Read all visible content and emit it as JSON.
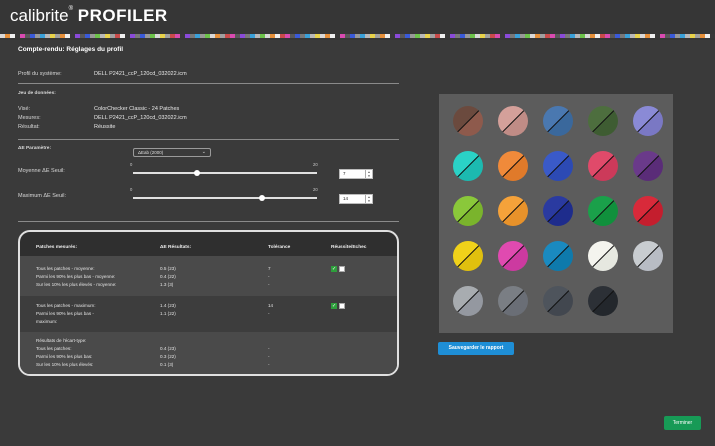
{
  "app": {
    "logo_main": "calibrite",
    "logo_reg": "®",
    "logo_product": "PROFILER",
    "strip_colors": [
      "#d8d8d8",
      "#b8b8b8",
      "#989898",
      "#787878",
      "#585858",
      "#383838",
      "#c94b4b",
      "#e6903a",
      "#e8d24a",
      "#6cc24a",
      "#3aa0d8",
      "#3a5ad8",
      "#8a4ad8",
      "#d84ab0",
      "#f0f0f0",
      "#a0a0a0"
    ]
  },
  "page": {
    "title": "Compte-rendu: Réglages du profil",
    "system_profile_label": "Profil du système:",
    "system_profile_value": "DELL P2421_ccP_120cd_032022.icm"
  },
  "dataset": {
    "heading": "Jeu de données:",
    "rows": [
      {
        "label": "Visé:",
        "value": "ColorChecker Classic - 24 Patches"
      },
      {
        "label": "Mesures:",
        "value": "DELL P2421_ccP_120cd_032022.icm"
      },
      {
        "label": "Résultat:",
        "value": "Réussite"
      }
    ]
  },
  "params": {
    "heading": "ΔE Paramètre:",
    "select_value": "ΔEab (2000)",
    "avg_label": "Moyenne ΔE Seuil:",
    "avg_min": "0",
    "avg_max": "20",
    "avg_value": "7",
    "avg_fraction": 0.35,
    "max_label": "Maximum ΔE Seuil:",
    "max_min": "0",
    "max_max": "20",
    "max_value": "14",
    "max_fraction": 0.7
  },
  "table": {
    "headers": [
      "Patches mesurés:",
      "ΔE Résultats:",
      "Tolérance",
      "Réussite/Echec"
    ],
    "groups": [
      {
        "rows": [
          {
            "label": "Tous les patches - moyenne:",
            "result": "0.5 (23)",
            "tol": "7",
            "check": true
          },
          {
            "label": "Parmi les 90% les plus bas - moyenne:",
            "result": "0.4 (22)",
            "tol": "-",
            "check": false
          },
          {
            "label": "Sur les 10% les plus élevés - moyenne:",
            "result": "1.3 (3)",
            "tol": "-",
            "check": false
          }
        ]
      },
      {
        "rows": [
          {
            "label": "Tous les patches - maximum:",
            "result": "1.4 (23)",
            "tol": "14",
            "check": true
          },
          {
            "label": "Parmi les 90% les plus bas -",
            "result": "1.1 (22)",
            "tol": "-",
            "check": false
          },
          {
            "label": "maximum:",
            "result": "",
            "tol": "",
            "check": false
          }
        ]
      },
      {
        "rows": [
          {
            "label": "Résultats de l'écart-type:",
            "result": "",
            "tol": "",
            "check": false
          },
          {
            "label": "Tous les patches:",
            "result": "0.4 (23)",
            "tol": "-",
            "check": false
          },
          {
            "label": "Parmi les 90% les plus bas:",
            "result": "0.3 (22)",
            "tol": "-",
            "check": false
          },
          {
            "label": "Sur les 10% les plus élevés:",
            "result": "0.1 (3)",
            "tol": "-",
            "check": false
          }
        ]
      }
    ]
  },
  "patches": [
    [
      "#6b4a3e",
      "#8e5a4c"
    ],
    [
      "#d4a09a",
      "#c08c86"
    ],
    [
      "#4a78b0",
      "#3a689c"
    ],
    [
      "#4d6e3e",
      "#3e5c32"
    ],
    [
      "#8a8ad6",
      "#7a78c4"
    ],
    [
      "#2ad2c6",
      "#1cbab0"
    ],
    [
      "#f08a3a",
      "#e07a2a"
    ],
    [
      "#3a5ac8",
      "#2c4ab4"
    ],
    [
      "#e04a6a",
      "#cc3a5a"
    ],
    [
      "#6a3a8a",
      "#5a2c78"
    ],
    [
      "#8ac83a",
      "#7ab42c"
    ],
    [
      "#f5a23a",
      "#e8922a"
    ],
    [
      "#2a3aa0",
      "#1e2c8c"
    ],
    [
      "#1aa04a",
      "#10903c"
    ],
    [
      "#d82a3a",
      "#c41e2e"
    ],
    [
      "#f0d21a",
      "#e0c00e"
    ],
    [
      "#e04ab0",
      "#cc3aa0"
    ],
    [
      "#1a8ac0",
      "#0e7aac"
    ],
    [
      "#f4f4ee",
      "#e6e8e0"
    ],
    [
      "#c8ccd0",
      "#b8bcc4"
    ],
    [
      "#a8acb0",
      "#9498a0"
    ],
    [
      "#7a7e84",
      "#6a6e76"
    ],
    [
      "#4e545c",
      "#42474f"
    ],
    [
      "#2c3036",
      "#23272c"
    ]
  ],
  "buttons": {
    "save": "Sauvegarder le rapport",
    "finish": "Terminer"
  }
}
